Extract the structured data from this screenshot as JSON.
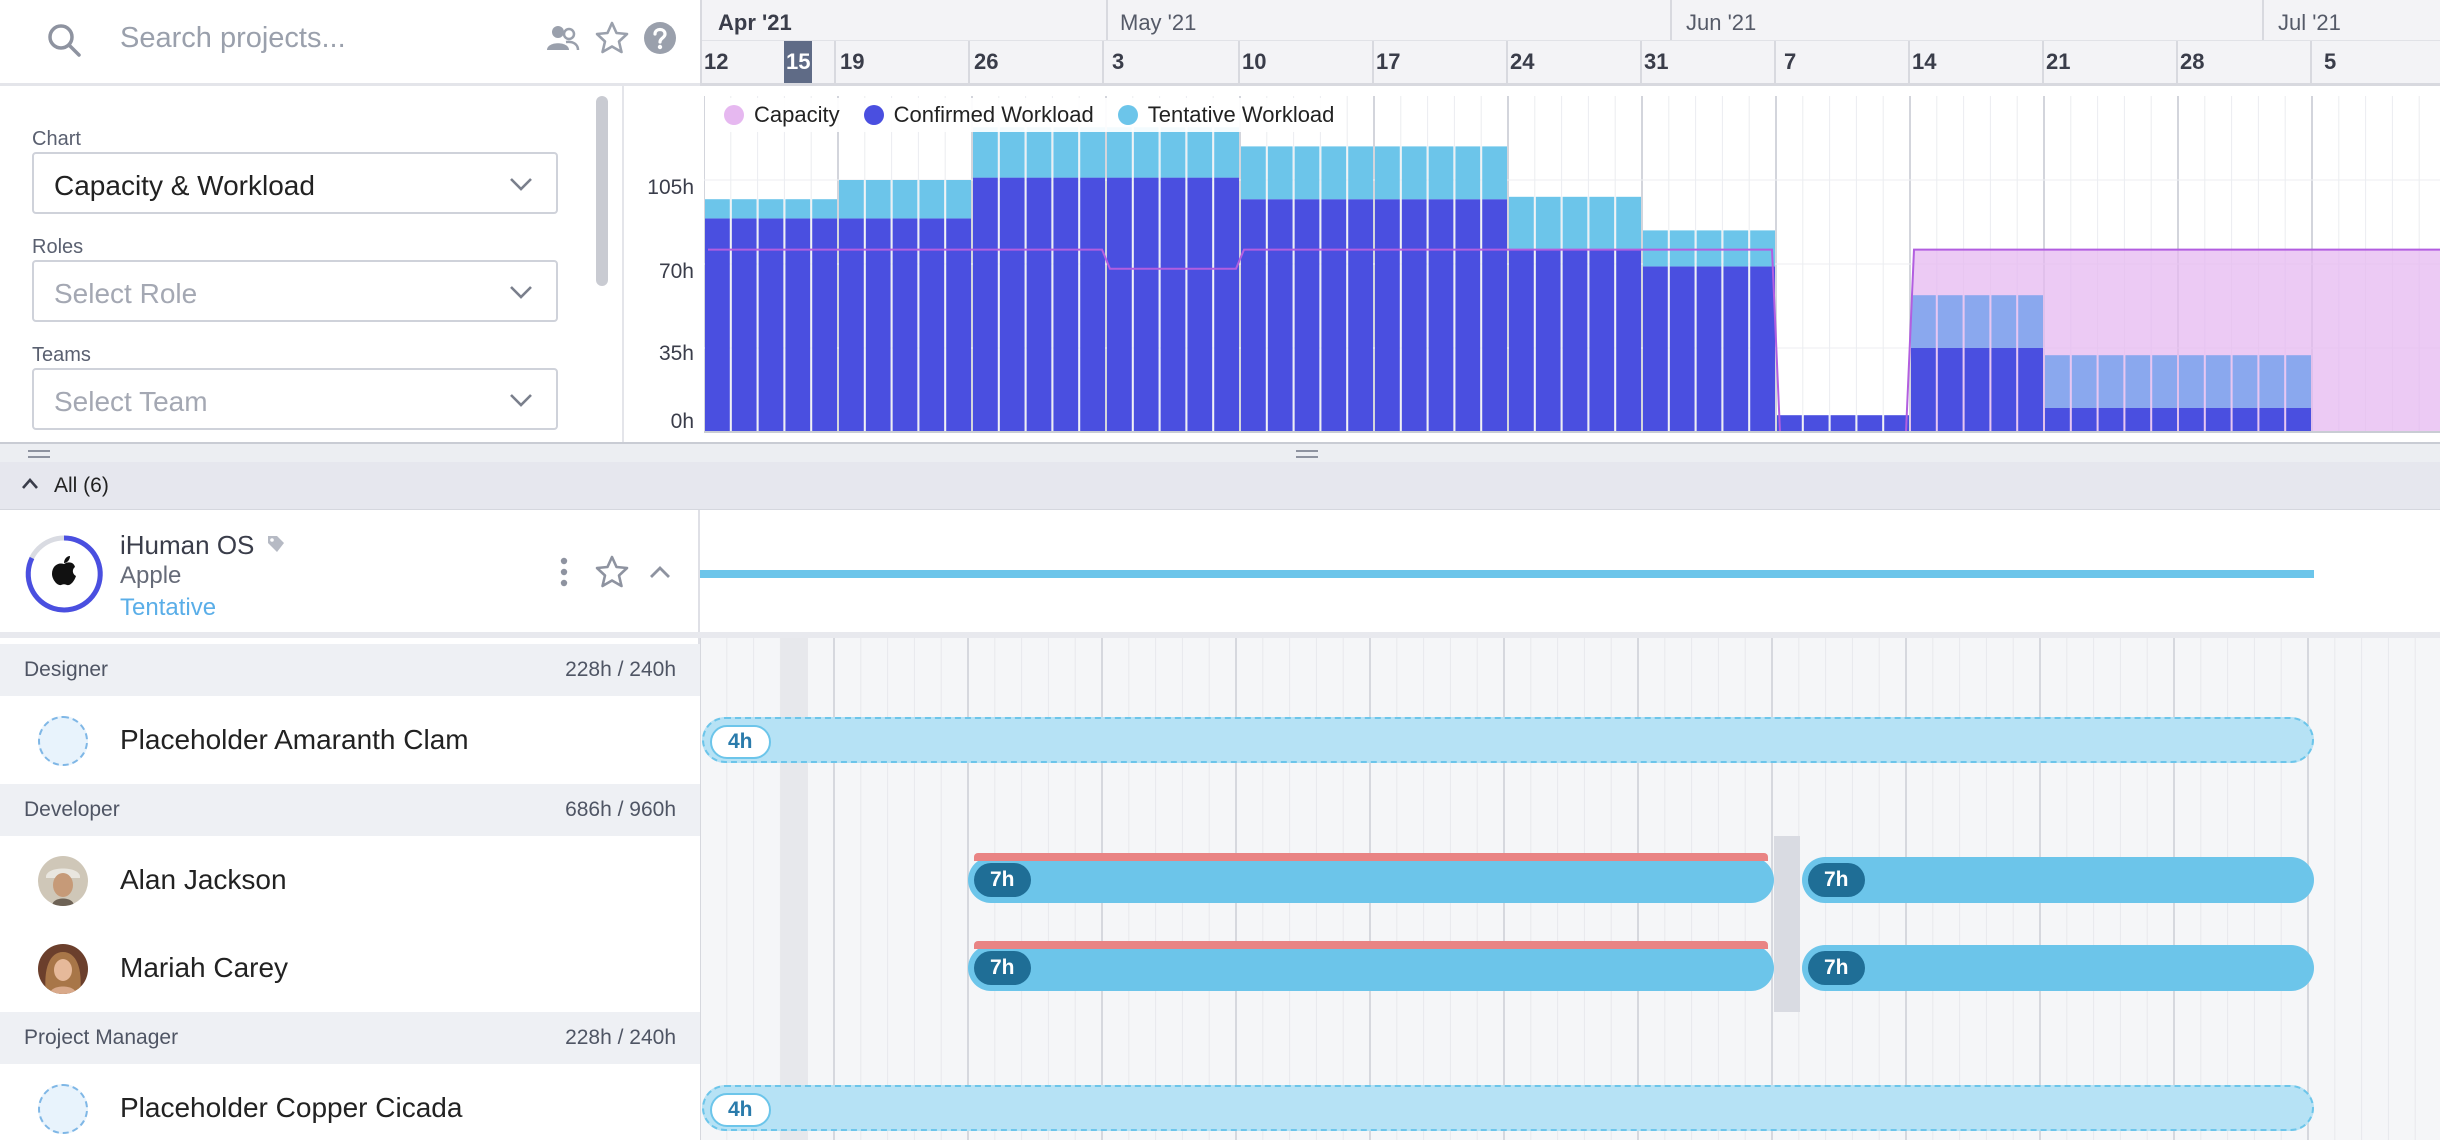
{
  "search": {
    "placeholder": "Search projects..."
  },
  "header_icons": [
    "people-icon",
    "star-icon",
    "help-icon"
  ],
  "timeline": {
    "months": [
      "Apr '21",
      "May '21",
      "Jun '21",
      "Jul '21"
    ],
    "weeks": [
      "12",
      "15",
      "19",
      "26",
      "3",
      "10",
      "17",
      "24",
      "31",
      "7",
      "14",
      "21",
      "28",
      "5"
    ],
    "today": "15"
  },
  "controls": {
    "chart_label": "Chart",
    "chart_value": "Capacity & Workload",
    "roles_label": "Roles",
    "roles_placeholder": "Select Role",
    "teams_label": "Teams",
    "teams_placeholder": "Select Team"
  },
  "chart_data": {
    "type": "bar",
    "title": "",
    "xlabel": "",
    "ylabel": "",
    "y_ticks": [
      "105h",
      "70h",
      "35h",
      "0h"
    ],
    "ylim": [
      0,
      140
    ],
    "legend": [
      {
        "name": "Capacity",
        "color": "#e6b8f0"
      },
      {
        "name": "Confirmed Workload",
        "color": "#4a4fe0"
      },
      {
        "name": "Tentative Workload",
        "color": "#6cc5ea"
      }
    ],
    "weeks": [
      "Apr 12",
      "Apr 19",
      "Apr 26",
      "May 3",
      "May 10",
      "May 17",
      "May 24",
      "May 31",
      "Jun 7",
      "Jun 14",
      "Jun 21",
      "Jun 28"
    ],
    "series": [
      {
        "name": "Confirmed Workload",
        "values": [
          89,
          89,
          106,
          106,
          97,
          97,
          76,
          69,
          7,
          35,
          10,
          10
        ]
      },
      {
        "name": "Tentative Workload",
        "values": [
          8,
          16,
          21,
          21,
          22,
          22,
          22,
          15,
          0,
          22,
          22,
          22
        ]
      },
      {
        "name": "Capacity",
        "values": [
          76,
          76,
          76,
          68,
          76,
          76,
          76,
          76,
          0,
          76,
          76,
          76
        ]
      }
    ]
  },
  "group": {
    "label": "All (6)"
  },
  "project": {
    "name": "iHuman OS",
    "client": "Apple",
    "status": "Tentative"
  },
  "roles": [
    {
      "role": "Designer",
      "hours": "228h / 240h"
    },
    {
      "role": "Developer",
      "hours": "686h / 960h"
    },
    {
      "role": "Project Manager",
      "hours": "228h / 240h"
    }
  ],
  "people": [
    {
      "name": "Placeholder Amaranth Clam",
      "bars": [
        "4h"
      ]
    },
    {
      "name": "Alan Jackson",
      "bars": [
        "7h",
        "7h"
      ]
    },
    {
      "name": "Mariah Carey",
      "bars": [
        "7h",
        "7h"
      ]
    },
    {
      "name": "Placeholder Copper Cicada",
      "bars": [
        "4h"
      ]
    }
  ],
  "colors": {
    "accent": "#4a4fe0",
    "tentative": "#6cc5ea",
    "capacity": "#e6b8f0",
    "overallocated": "#e98484"
  }
}
